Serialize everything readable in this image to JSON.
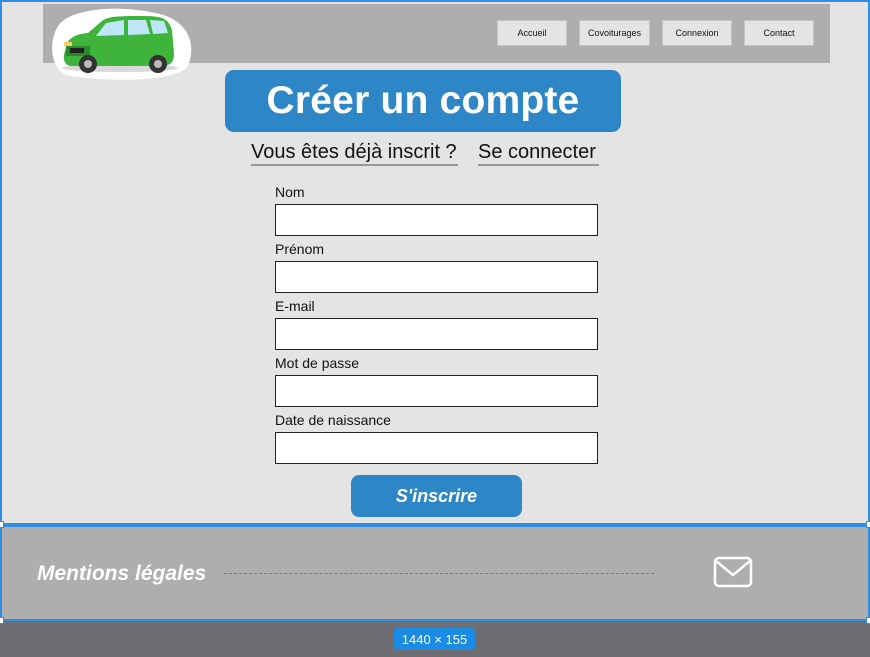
{
  "nav": {
    "items": [
      {
        "label": "Accueil"
      },
      {
        "label": "Covoiturages"
      },
      {
        "label": "Connexion"
      },
      {
        "label": "Contact"
      }
    ]
  },
  "logo": {
    "icon": "car-icon",
    "car_color": "#3fb43a"
  },
  "page": {
    "title": "Créer un compte"
  },
  "login": {
    "question": "Vous êtes déjà inscrit ?",
    "link": "Se connecter"
  },
  "form": {
    "fields": [
      {
        "label": "Nom",
        "value": ""
      },
      {
        "label": "Prénom",
        "value": ""
      },
      {
        "label": "E-mail",
        "value": ""
      },
      {
        "label": "Mot de passe",
        "value": ""
      },
      {
        "label": "Date de naissance",
        "value": ""
      }
    ],
    "submit_label": "S'inscrire"
  },
  "footer": {
    "legal": "Mentions légales",
    "mail_icon": "mail-icon"
  },
  "canvas": {
    "size_badge": "1440 × 155"
  },
  "colors": {
    "accent": "#2d86c6",
    "selection": "#2f8ee0",
    "nav_bg": "#aeaeae",
    "page_bg": "#e4e4e4"
  }
}
